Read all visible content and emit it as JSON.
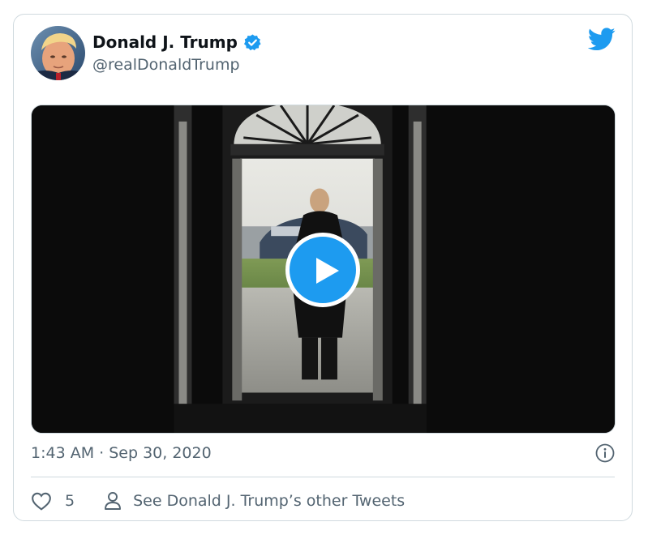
{
  "tweet": {
    "display_name": "Donald J. Trump",
    "handle": "@realDonaldTrump",
    "timestamp": "1:43 AM · Sep 30, 2020",
    "like_count": "5",
    "other_tweets_label": "See Donald J. Trump’s other Tweets"
  },
  "icons": {
    "verified": "verified-badge-icon",
    "brand": "twitter-bird-icon",
    "play": "play-icon",
    "info": "info-icon",
    "like": "heart-icon",
    "profile": "person-icon"
  },
  "colors": {
    "accent": "#1d9bf0",
    "text_primary": "#0f1419",
    "text_secondary": "#536471",
    "border": "#cfd9de"
  }
}
